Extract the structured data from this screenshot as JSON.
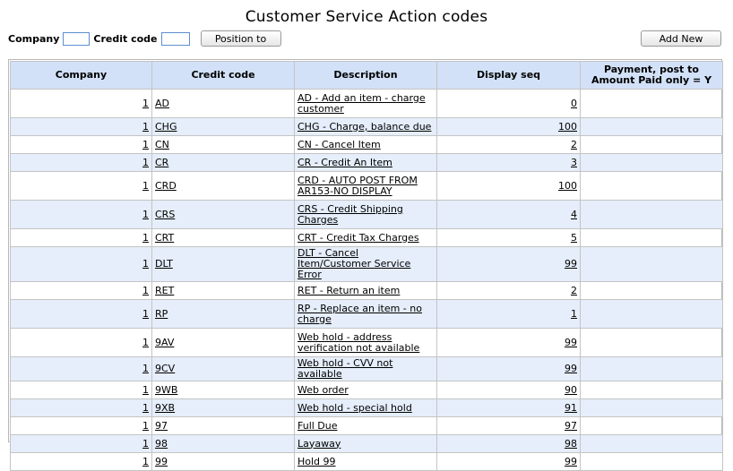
{
  "page": {
    "title": "Customer Service Action codes"
  },
  "filter": {
    "company_label": "Company",
    "company_value": "",
    "credit_code_label": "Credit code",
    "credit_code_value": "",
    "position_button": "Position to"
  },
  "toolbar": {
    "add_new_button": "Add New"
  },
  "table": {
    "headers": {
      "company": "Company",
      "credit_code": "Credit code",
      "description": "Description",
      "display_seq": "Display seq",
      "payment": "Payment, post to Amount Paid only = Y"
    },
    "rows": [
      {
        "company": "1",
        "code": "AD",
        "description": "AD - Add an item - charge customer",
        "seq": "0",
        "payment": ""
      },
      {
        "company": "1",
        "code": "CHG",
        "description": "CHG - Charge, balance due",
        "seq": "100",
        "payment": ""
      },
      {
        "company": "1",
        "code": "CN",
        "description": "CN - Cancel Item",
        "seq": "2",
        "payment": ""
      },
      {
        "company": "1",
        "code": "CR",
        "description": "CR - Credit An Item",
        "seq": "3",
        "payment": ""
      },
      {
        "company": "1",
        "code": "CRD",
        "description": "CRD - AUTO POST FROM AR153-NO DISPLAY",
        "seq": "100",
        "payment": ""
      },
      {
        "company": "1",
        "code": "CRS",
        "description": "CRS - Credit Shipping Charges",
        "seq": "4",
        "payment": ""
      },
      {
        "company": "1",
        "code": "CRT",
        "description": "CRT - Credit Tax Charges",
        "seq": "5",
        "payment": ""
      },
      {
        "company": "1",
        "code": "DLT",
        "description": "DLT - Cancel Item/Customer Service Error",
        "seq": "99",
        "payment": ""
      },
      {
        "company": "1",
        "code": "RET",
        "description": "RET - Return an item",
        "seq": "2",
        "payment": ""
      },
      {
        "company": "1",
        "code": "RP",
        "description": "RP - Replace an item - no charge",
        "seq": "1",
        "payment": ""
      },
      {
        "company": "1",
        "code": "9AV",
        "description": "Web hold - address verification not available",
        "seq": "99",
        "payment": ""
      },
      {
        "company": "1",
        "code": "9CV",
        "description": "Web hold - CVV not available",
        "seq": "99",
        "payment": ""
      },
      {
        "company": "1",
        "code": "9WB",
        "description": "Web order",
        "seq": "90",
        "payment": ""
      },
      {
        "company": "1",
        "code": "9XB",
        "description": "Web hold - special hold",
        "seq": "91",
        "payment": ""
      },
      {
        "company": "1",
        "code": "97",
        "description": "Full Due",
        "seq": "97",
        "payment": ""
      },
      {
        "company": "1",
        "code": "98",
        "description": "Layaway",
        "seq": "98",
        "payment": ""
      },
      {
        "company": "1",
        "code": "99",
        "description": "Hold 99",
        "seq": "99",
        "payment": ""
      }
    ]
  }
}
